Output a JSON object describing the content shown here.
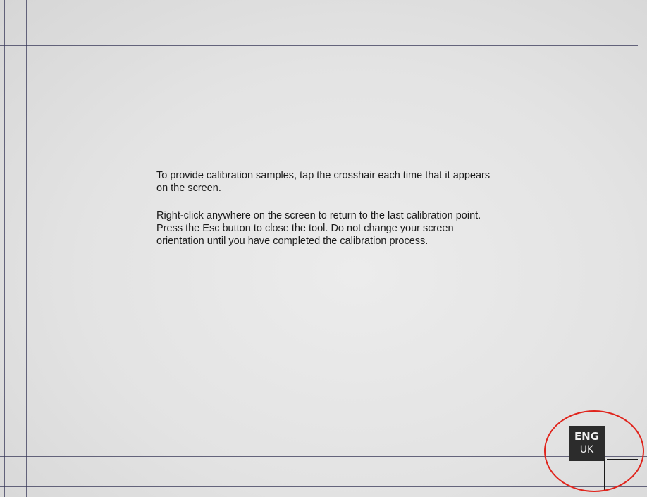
{
  "calibration": {
    "paragraph1": "To provide calibration samples, tap the crosshair each time that it appears on the screen.",
    "paragraph2": "Right-click anywhere on the screen to return to the last calibration point. Press the Esc button to close the tool. Do not change your screen orientation until you have completed the calibration process."
  },
  "language_indicator": {
    "code": "ENG",
    "region": "UK"
  },
  "crosshair": {
    "icon": "crosshair-icon"
  },
  "annotation": {
    "color": "#e0241c"
  }
}
